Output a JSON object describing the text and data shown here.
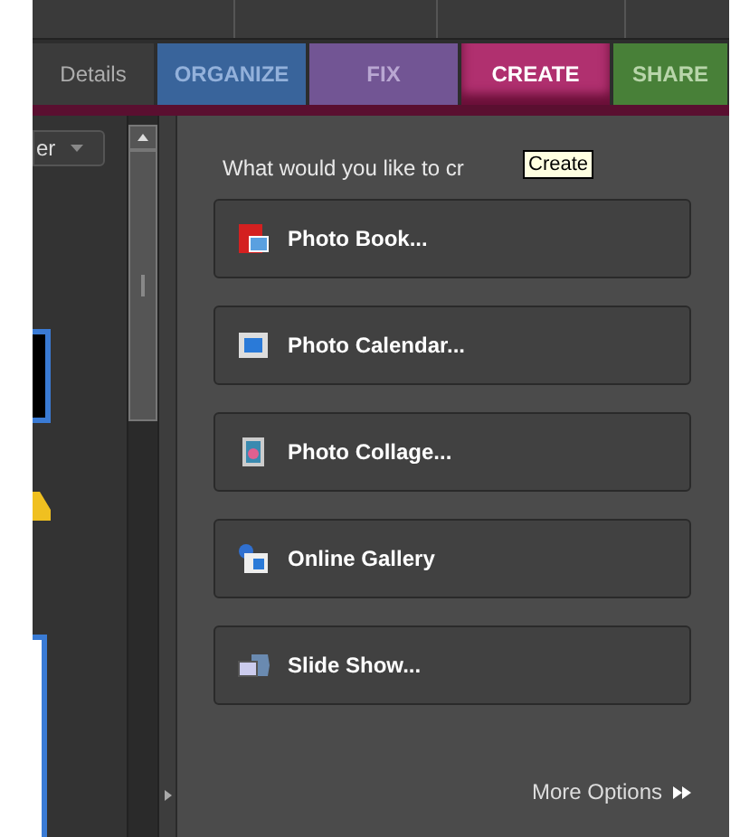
{
  "tabs": [
    {
      "label": "Details",
      "kind": "plain",
      "selected": false
    },
    {
      "label": "ORGANIZE",
      "kind": "organize",
      "selected": false
    },
    {
      "label": "FIX",
      "kind": "fix",
      "selected": false
    },
    {
      "label": "CREATE",
      "kind": "create",
      "selected": true
    },
    {
      "label": "SHARE",
      "kind": "share",
      "selected": false
    }
  ],
  "left_panel": {
    "dropdown": "er"
  },
  "create_panel": {
    "heading": "What would you like to cr",
    "tooltip": "Create",
    "options": [
      {
        "label": "Photo Book...",
        "kind": "book"
      },
      {
        "label": "Photo Calendar...",
        "kind": "calendar"
      },
      {
        "label": "Photo Collage...",
        "kind": "collage"
      },
      {
        "label": "Online Gallery",
        "kind": "gallery"
      },
      {
        "label": "Slide Show...",
        "kind": "slideshow"
      }
    ],
    "more_options": "More Options"
  }
}
